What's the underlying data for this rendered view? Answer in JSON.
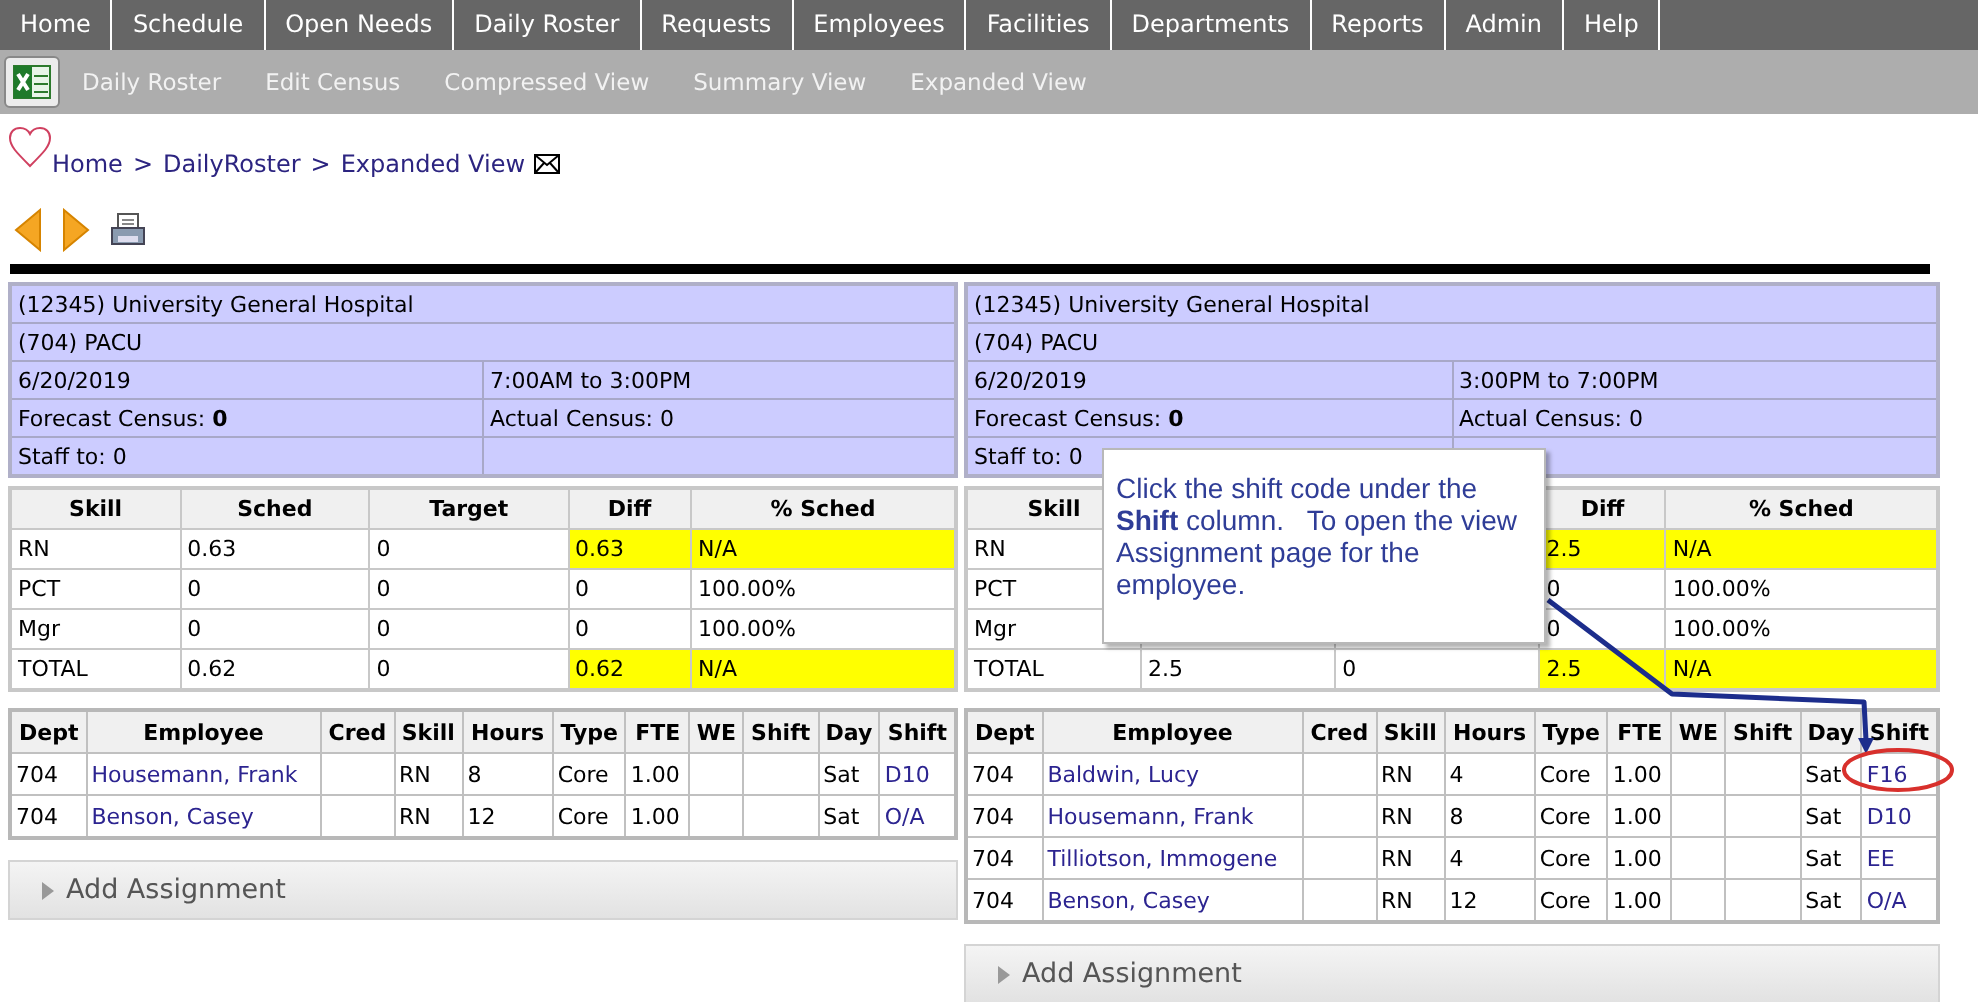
{
  "nav": {
    "items": [
      "Home",
      "Schedule",
      "Open Needs",
      "Daily Roster",
      "Requests",
      "Employees",
      "Facilities",
      "Departments",
      "Reports",
      "Admin",
      "Help"
    ]
  },
  "subnav": {
    "items": [
      "Daily Roster",
      "Edit Census",
      "Compressed View",
      "Summary View",
      "Expanded View"
    ]
  },
  "breadcrumb": {
    "items": [
      "Home",
      "DailyRoster",
      "Expanded View"
    ],
    "separator": ">"
  },
  "panels": [
    {
      "facility": "(12345) University General Hospital",
      "department": "(704) PACU",
      "date": "6/20/2019",
      "shift_time": "7:00AM to 3:00PM",
      "forecast": "Forecast Census: **0**",
      "actual": "Actual Census: 0",
      "staff_to": "Staff to: 0",
      "skill_table": {
        "columns": [
          "Skill",
          "Sched",
          "Target",
          "Diff",
          "% Sched"
        ],
        "rows": [
          {
            "cells": [
              "RN",
              "0.63",
              "0",
              "0.63",
              "N/A"
            ],
            "highlighted": true
          },
          {
            "cells": [
              "PCT",
              "0",
              "0",
              "0",
              "100.00%"
            ],
            "highlighted": false
          },
          {
            "cells": [
              "Mgr",
              "0",
              "0",
              "0",
              "100.00%"
            ],
            "highlighted": false
          },
          {
            "cells": [
              "TOTAL",
              "0.62",
              "0",
              "0.62",
              "N/A"
            ],
            "highlighted": true
          }
        ]
      },
      "roster": {
        "columns": [
          {
            "label": "Dept",
            "kind": "text"
          },
          {
            "label": "Employee",
            "kind": "link"
          },
          {
            "label": "Cred",
            "kind": "text"
          },
          {
            "label": "Skill",
            "kind": "text"
          },
          {
            "label": "Hours",
            "kind": "text"
          },
          {
            "label": "Type",
            "kind": "text"
          },
          {
            "label": "FTE",
            "kind": "text"
          },
          {
            "label": "WE",
            "kind": "text"
          },
          {
            "label": "Shift",
            "kind": "text"
          },
          {
            "label": "Day",
            "kind": "text"
          },
          {
            "label": "Shift",
            "kind": "link"
          }
        ],
        "rows": [
          [
            "704",
            "Housemann, Frank",
            null,
            "RN",
            "8",
            "Core",
            "1.00",
            null,
            null,
            "Sat",
            "D10"
          ],
          [
            "704",
            "Benson, Casey",
            null,
            "RN",
            "12",
            "Core",
            "1.00",
            null,
            null,
            "Sat",
            "O/A"
          ]
        ]
      },
      "add_assignment": "Add Assignment"
    },
    {
      "facility": "(12345) University General Hospital",
      "department": "(704) PACU",
      "date": "6/20/2019",
      "shift_time": "3:00PM to 7:00PM",
      "forecast": "Forecast Census: **0**",
      "actual": "Actual Census: 0",
      "staff_to": "Staff to: 0",
      "skill_table": {
        "columns": [
          "Skill",
          null,
          null,
          "Diff",
          "% Sched"
        ],
        "rows": [
          {
            "cells": [
              "RN",
              null,
              null,
              "2.5",
              "N/A"
            ],
            "highlighted": true
          },
          {
            "cells": [
              "PCT",
              null,
              null,
              "0",
              "100.00%"
            ],
            "highlighted": false
          },
          {
            "cells": [
              "Mgr",
              null,
              null,
              "0",
              "100.00%"
            ],
            "highlighted": false
          },
          {
            "cells": [
              "TOTAL",
              "2.5",
              "0",
              "2.5",
              "N/A"
            ],
            "highlighted": true
          }
        ]
      },
      "roster": {
        "columns": [
          {
            "label": "Dept",
            "kind": "text"
          },
          {
            "label": "Employee",
            "kind": "link"
          },
          {
            "label": "Cred",
            "kind": "text"
          },
          {
            "label": "Skill",
            "kind": "text"
          },
          {
            "label": "Hours",
            "kind": "text"
          },
          {
            "label": "Type",
            "kind": "text"
          },
          {
            "label": "FTE",
            "kind": "text"
          },
          {
            "label": "WE",
            "kind": "text"
          },
          {
            "label": "Shift",
            "kind": "text"
          },
          {
            "label": "Day",
            "kind": "text"
          },
          {
            "label": "Shift",
            "kind": "link"
          }
        ],
        "rows": [
          [
            "704",
            "Baldwin, Lucy",
            null,
            "RN",
            "4",
            "Core",
            "1.00",
            null,
            null,
            "Sat",
            "F16"
          ],
          [
            "704",
            "Housemann, Frank",
            null,
            "RN",
            "8",
            "Core",
            "1.00",
            null,
            null,
            "Sat",
            "D10"
          ],
          [
            "704",
            "Tilliotson, Immogene",
            null,
            "RN",
            "4",
            "Core",
            "1.00",
            null,
            null,
            "Sat",
            "EE"
          ],
          [
            "704",
            "Benson, Casey",
            null,
            "RN",
            "12",
            "Core",
            "1.00",
            null,
            null,
            "Sat",
            "O/A"
          ]
        ]
      },
      "add_assignment": "Add Assignment"
    }
  ],
  "callout": {
    "text": "Click the shift code under the **Shift** column.   To open the view Assignment page for the employee."
  }
}
